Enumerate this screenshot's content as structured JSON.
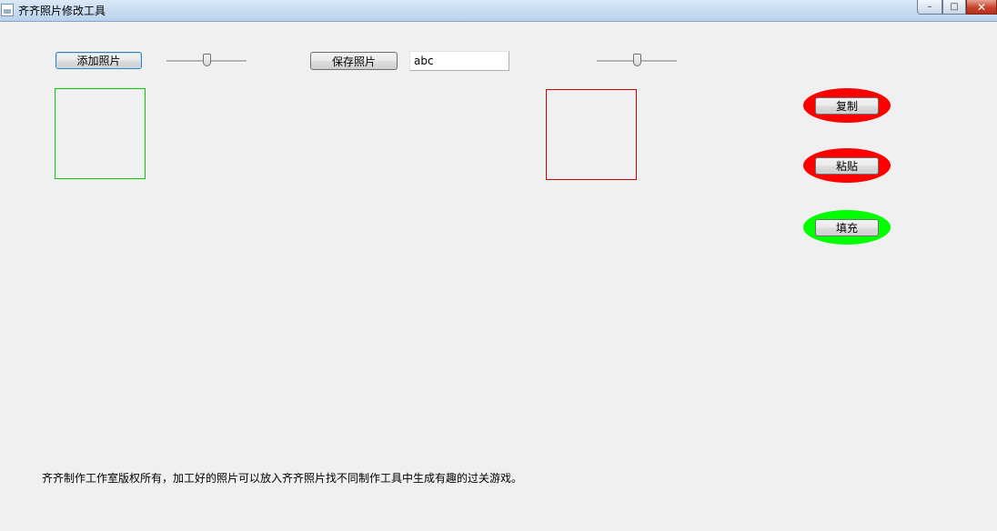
{
  "window": {
    "title": "齐齐照片修改工具",
    "controls": {
      "minimize": "–",
      "maximize": "□",
      "close": "✕"
    }
  },
  "toolbar": {
    "add_photo": "添加照片",
    "save_photo": "保存照片",
    "filename_value": "abc",
    "slider_left_level": 0.5,
    "slider_right_level": 0.5
  },
  "actions": {
    "copy": "复制",
    "paste": "粘贴",
    "fill": "填充"
  },
  "colors": {
    "left_frame": "#00cc00",
    "right_frame": "#cc0000",
    "copy_ellipse": "#ff0000",
    "paste_ellipse": "#ff0000",
    "fill_ellipse": "#00ff00"
  },
  "footer": {
    "text": "齐齐制作工作室版权所有，加工好的照片可以放入齐齐照片找不同制作工具中生成有趣的过关游戏。"
  }
}
